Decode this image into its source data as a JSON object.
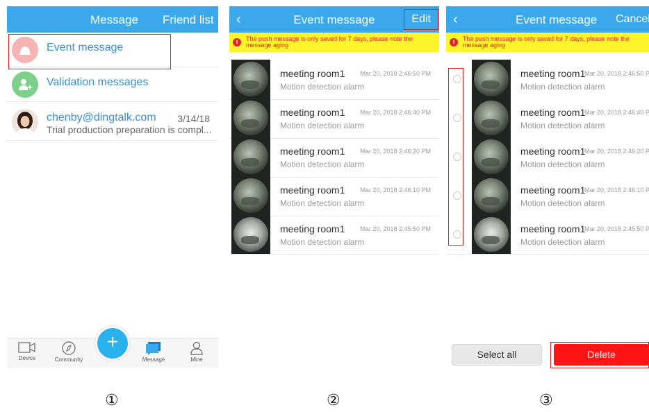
{
  "panel1": {
    "tabs": {
      "message": "Message",
      "friend_list": "Friend list"
    },
    "conversations": [
      {
        "name": "Event message",
        "icon": "event-bell-icon",
        "color": "#f5b3b3"
      },
      {
        "name": "Validation messages",
        "icon": "add-user-icon",
        "color": "#7cd08a"
      },
      {
        "name": "chenby@dingtalk.com",
        "preview": "Trial production preparation is compl...",
        "date": "3/14/18",
        "icon": "avatar-photo"
      }
    ],
    "bottom_nav": [
      {
        "label": "Device",
        "icon": "camera-icon"
      },
      {
        "label": "Community",
        "icon": "compass-icon"
      },
      {
        "label": "Message",
        "icon": "chat-bubbles-icon"
      },
      {
        "label": "Mine",
        "icon": "person-icon"
      }
    ],
    "fab": "+"
  },
  "panel2": {
    "back": "‹",
    "title": "Event message",
    "right_action": "Edit"
  },
  "panel3": {
    "back": "‹",
    "title": "Event message",
    "right_action": "Cancel",
    "select_all": "Select all",
    "delete": "Delete"
  },
  "notice": "The push message is only saved for 7 days, please note the message aging",
  "events": [
    {
      "place": "meeting room1",
      "type": "Motion detection alarm",
      "time": "Mar 20, 2018 2:46:50 PM"
    },
    {
      "place": "meeting room1",
      "type": "Motion detection alarm",
      "time": "Mar 20, 2018 2:46:40 PM"
    },
    {
      "place": "meeting room1",
      "type": "Motion detection alarm",
      "time": "Mar 20, 2018 2:46:20 PM"
    },
    {
      "place": "meeting room1",
      "type": "Motion detection alarm",
      "time": "Mar 20, 2018 2:46:10 PM"
    },
    {
      "place": "meeting room1",
      "type": "Motion detection alarm",
      "time": "Mar 20, 2018 2:45:50 PM"
    }
  ],
  "steps": [
    "①",
    "②",
    "③"
  ],
  "colors": {
    "header": "#3aa8ea",
    "notice_bg": "#fff52a",
    "notice_text": "#e02525",
    "delete": "#ff1414",
    "highlight": "#e02020"
  }
}
